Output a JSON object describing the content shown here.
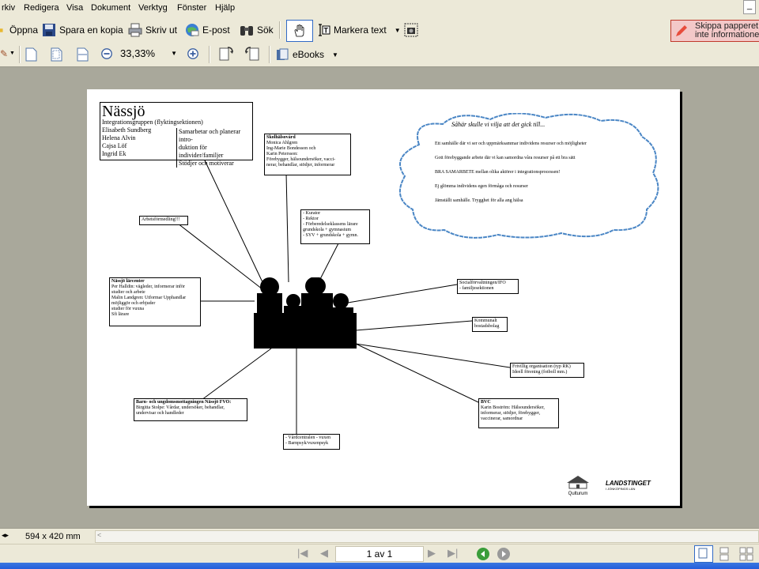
{
  "menu": [
    "rkiv",
    "Redigera",
    "Visa",
    "Dokument",
    "Verktyg",
    "Fönster",
    "Hjälp"
  ],
  "toolbar": {
    "open": "Öppna",
    "save_copy": "Spara en kopia",
    "print": "Skriv ut",
    "email": "E-post",
    "search": "Sök",
    "select_text": "Markera text",
    "zoom": "33,33%",
    "ebooks": "eBooks",
    "banner": "Skippa papperet",
    "banner2": "inte informatione"
  },
  "window_min": "_",
  "status": {
    "page_size": "594 x 420 mm"
  },
  "nav": {
    "page_indicator": "1 av 1"
  },
  "doc": {
    "title": "Nässjö",
    "main_lines": "Integrationsgruppen (flyktingsektionen)\nElisabeth Sundberg\nHelena Alvin\nCajsa Löf\nIngrid Ek",
    "main_desc": "Samarbetar och planerar intro-\nduktion för individer/familjer\nStödjer och motiverar",
    "cloud_heading": "Såhär skulle vi vilja att det gick till...",
    "cloud_lines": [
      "Ett samhälle där vi ser och uppmärksammar individens resurser och möjligheter",
      "Gott förebyggande arbete där vi kan samordna våra resurser på ett bra sätt",
      "BRA SAMARBETE mellan olika aktörer i integrationsprocessen!",
      "Ej glömma individens egen förmåga och resurser",
      "Jämställt samhälle. Trygghet för alla ang hälsa"
    ],
    "boxes": {
      "skolhalsovard_title": "Skolhälsovård",
      "skolhalsovard_text": "Monica Ahlgren\nIng-Marie Bondesson och\nKarin Petersson:\nFörebygger, hälsoundersöker, vacci-\nnerar, behandlar, stödjer, informerar",
      "arbetsformedling": "Arbetsförmedling!!!",
      "kurator": "- Kurator\n- Rektor\n- Förberedelseklassens lärare\ngrundskola + gymnasium\n- SYV + grundskola + gymn.",
      "larcenter_title": "Nässjö lärcenter",
      "larcenter_text": "Per Halldin: vägleder, informerar inför\nstudier och arbete\nMalin Landgren: Utformar Upphandlar\nmöjliggör och erbjuder\nstudier för vuxna\nSfi lärare",
      "social": "Socialförvaltningen/IFO\n- familjesektionen",
      "bostad": "Kommunalt\nbostadsbolag",
      "frivillig": "Frivillig organisation (typ RK)\nIdeell förening (fotboll mm.)",
      "bvc_title": "BVC",
      "bvc_text": "Karin Boström: Hälsoundersöker,\ninformerar, stödjer, förebygger,\nvaccinerar, samordnar",
      "bup_title": "Barn- och ungdomsmottagningen Nässjö FVO:",
      "bup_text": "Birgitta Stolpe: Vårdar, undersöker, behandlar,\nundervisar och handleder",
      "vard": "- Vårdcentralen - vuxen\n- Barnpsyk/vuxenpsyk"
    },
    "logo1": "Qulturum",
    "logo2": "LANDSTINGET",
    "logo2_sub": "I JÖNKÖPINGS LÄN"
  }
}
